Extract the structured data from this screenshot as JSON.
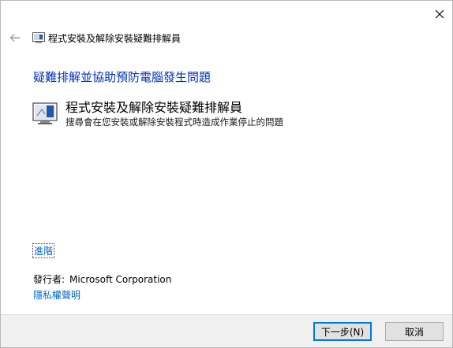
{
  "window": {
    "title": "程式安裝及解除安裝疑難排解員",
    "heading": "疑難排解並協助預防電腦發生問題"
  },
  "troubleshooter": {
    "title": "程式安裝及解除安裝疑難排解員",
    "description": "搜尋會在您安裝或解除安裝程式時造成作業停止的問題",
    "icon": "program-install-troubleshooter-icon"
  },
  "links": {
    "advanced": "進階",
    "privacy": "隱私權聲明"
  },
  "publisher": {
    "label": "發行者:",
    "name": "Microsoft Corporation"
  },
  "buttons": {
    "next": "下一步(N)",
    "cancel": "取消"
  },
  "colors": {
    "heading": "#0033bc",
    "link": "#0066cc",
    "footer_bg": "#f0f0f0",
    "default_button_border": "#0078d7"
  }
}
